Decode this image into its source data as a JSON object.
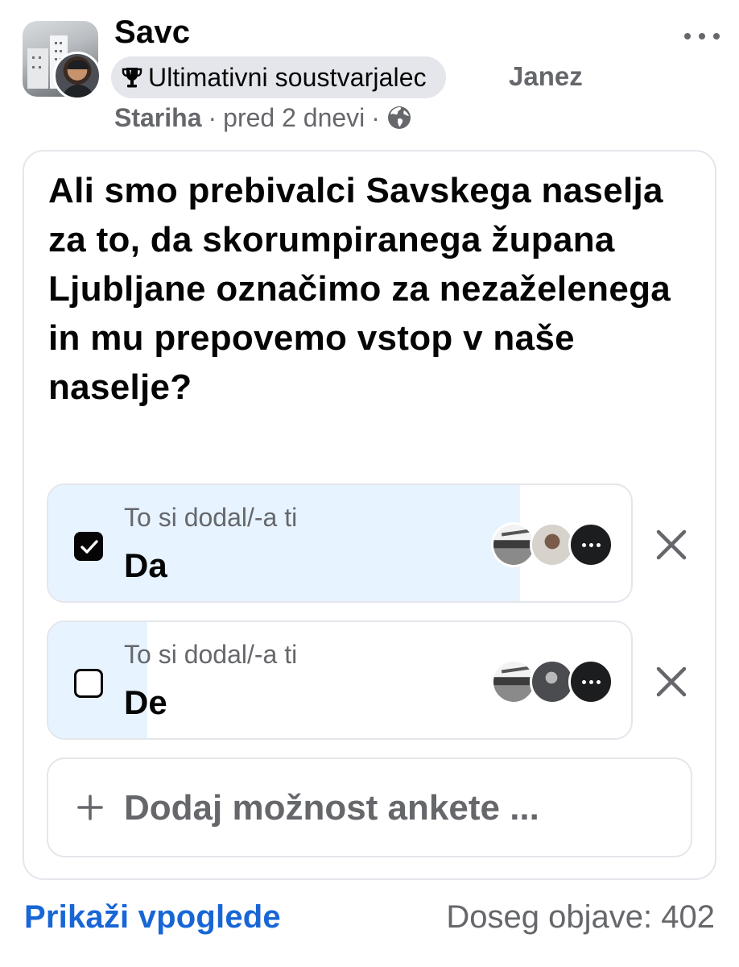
{
  "post": {
    "group_name": "Savc",
    "badge_label": "Ultimativni soustvarjalec",
    "author_first": "Janez",
    "author_last": "Stariha",
    "separator": "·",
    "time_ago": "pred 2 dnevi",
    "audience_icon": "globe-icon",
    "more_icon": "more-icon"
  },
  "poll": {
    "question": "Ali smo prebivalci Savskega naselja za to, da skorumpiranega župana Ljubljane označimo za nezaželenega in mu prepovemo vstop v naše naselje?",
    "options": [
      {
        "added_by": "To si dodal/-a ti",
        "label": "Da",
        "checked": true,
        "vote_fraction": 0.81
      },
      {
        "added_by": "To si dodal/-a ti",
        "label": "De",
        "checked": false,
        "vote_fraction": 0.17
      }
    ],
    "add_option_label": "Dodaj možnost ankete ..."
  },
  "footer": {
    "insights_label": "Prikaži vpoglede",
    "reach_label": "Doseg objave: 402"
  },
  "colors": {
    "vote_fill": "#e7f3ff",
    "link_blue": "#1866d6",
    "secondary_text": "#65676b",
    "border": "#e4e6eb"
  }
}
